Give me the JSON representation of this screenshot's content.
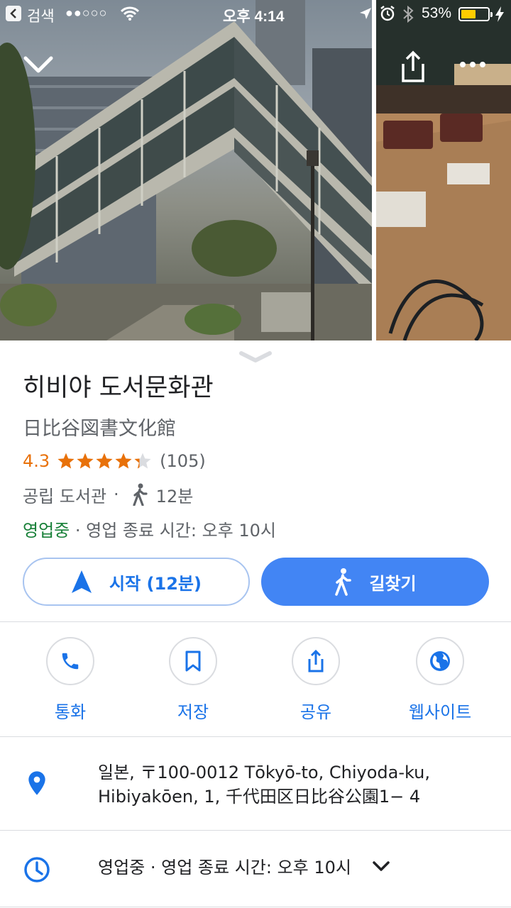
{
  "status_bar": {
    "back_app": "검색",
    "signal": "●●○○○",
    "time": "오후 4:14",
    "battery": "53%",
    "battery_level": 0.53
  },
  "place": {
    "name_ko": "히비야 도서문화관",
    "name_ja": "日比谷図書文化館",
    "rating": "4.3",
    "rating_value": 4.3,
    "reviews": "(105)",
    "category": "공립 도서관",
    "separator": "·",
    "walk_time": "12분",
    "open_status": "영업중",
    "closing": "· 영업 종료 시간: 오후 10시"
  },
  "actions": {
    "start": "시작 (12분)",
    "directions": "길찾기"
  },
  "quick_actions": [
    {
      "label": "통화",
      "icon": "phone-icon"
    },
    {
      "label": "저장",
      "icon": "bookmark-icon"
    },
    {
      "label": "공유",
      "icon": "share-icon"
    },
    {
      "label": "웹사이트",
      "icon": "globe-icon"
    }
  ],
  "address": {
    "line1": "일본, 〒100-0012 Tōkyō-to, Chiyoda-ku,",
    "line2": "Hibiyakōen, 1, 千代田区日比谷公園1− 4"
  },
  "hours": {
    "open_status": "영업중",
    "closing": "· 영업 종료 시간: 오후 10시"
  },
  "colors": {
    "accent": "#1a73e8",
    "button_fill": "#4285f4",
    "rating": "#e8710a",
    "open": "#188038",
    "secondary_text": "#5f6368"
  }
}
